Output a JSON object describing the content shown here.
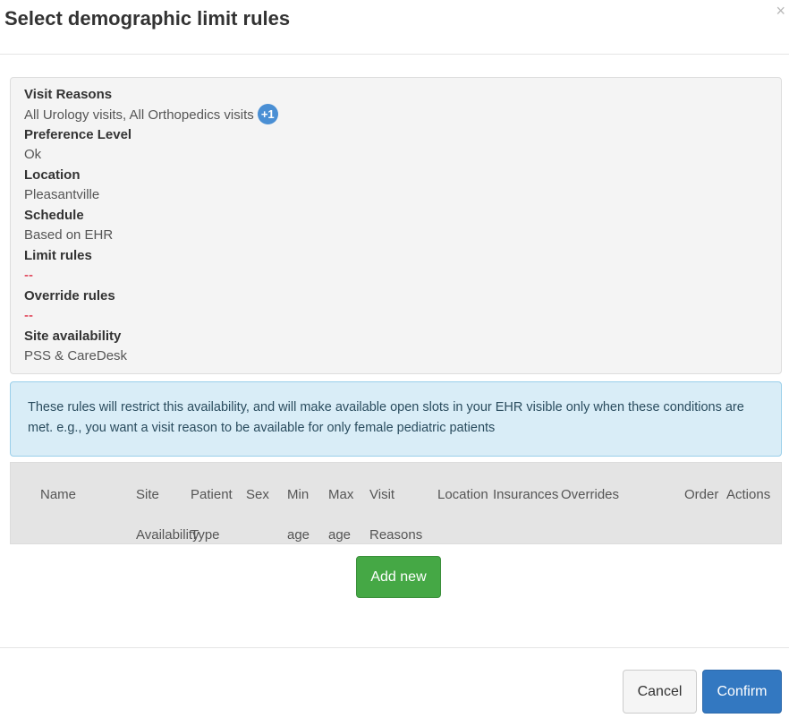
{
  "modal": {
    "title": "Select demographic limit rules",
    "close_label": "×"
  },
  "summary": {
    "visit_reasons_label": "Visit Reasons",
    "visit_reasons_value": "All Urology visits, All Orthopedics visits",
    "visit_reasons_more": "+1",
    "preference_level_label": "Preference Level",
    "preference_level_value": "Ok",
    "location_label": "Location",
    "location_value": "Pleasantville",
    "schedule_label": "Schedule",
    "schedule_value": "Based on EHR",
    "limit_rules_label": "Limit rules",
    "limit_rules_value": "--",
    "override_rules_label": "Override rules",
    "override_rules_value": "--",
    "site_availability_label": "Site availability",
    "site_availability_value": "PSS & CareDesk"
  },
  "info": {
    "text": "These rules will restrict this availability, and will make available open slots in your EHR visible only when these conditions are met. e.g., you want a visit reason to be available for only female pediatric patients"
  },
  "table": {
    "columns": {
      "name": "Name",
      "site_availability_1": "Site",
      "site_availability_2": "Availability",
      "patient_type_1": "Patient",
      "patient_type_2": "Type",
      "sex": "Sex",
      "min_age_1": "Min",
      "min_age_2": "age",
      "max_age_1": "Max",
      "max_age_2": "age",
      "visit_reasons_1": "Visit",
      "visit_reasons_2": "Reasons",
      "location": "Location",
      "insurances": "Insurances",
      "overrides": "Overrides",
      "order": "Order",
      "actions": "Actions"
    }
  },
  "buttons": {
    "add_new": "Add new",
    "cancel": "Cancel",
    "confirm": "Confirm"
  }
}
